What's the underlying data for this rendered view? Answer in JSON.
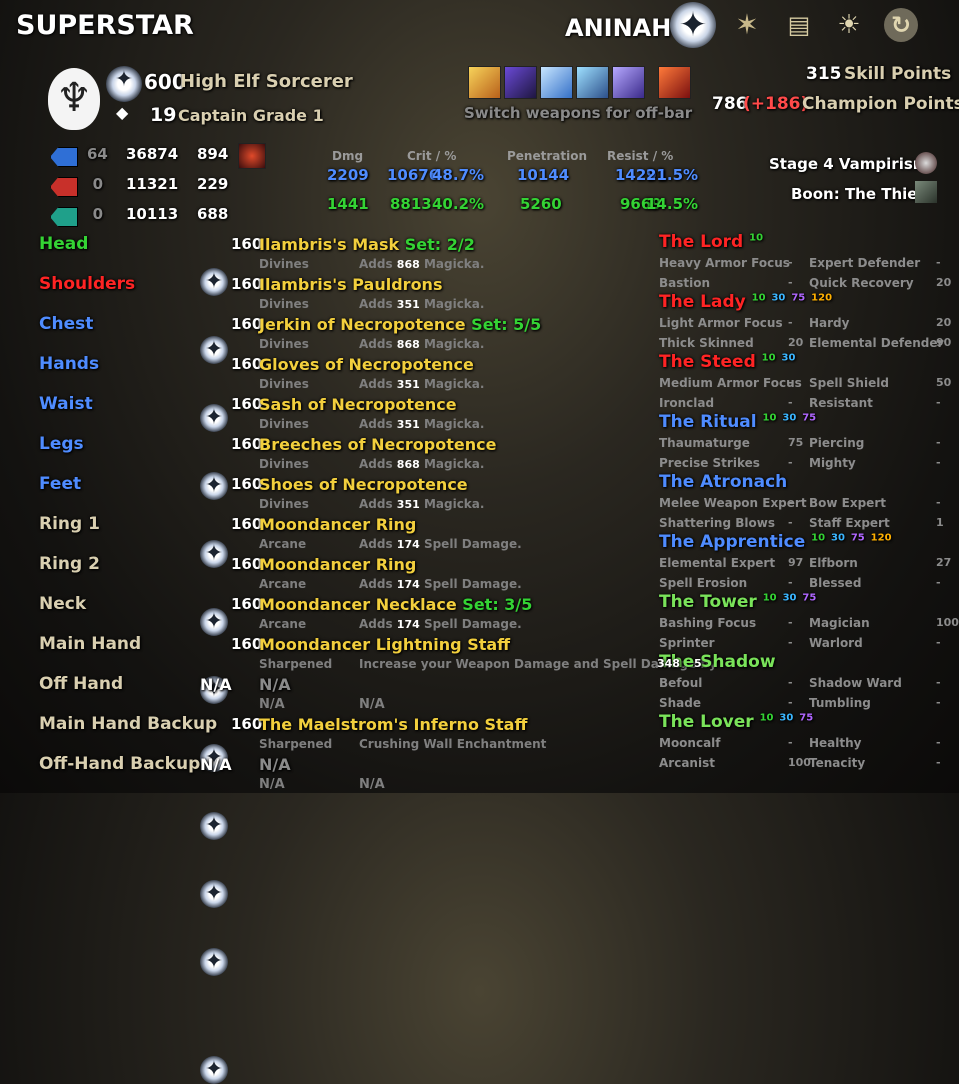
{
  "header": {
    "player_name": "SUPERSTAR",
    "character_name": "ANINAH",
    "nav_icons": [
      "compass-rose-icon",
      "star-compass-icon",
      "scroll-icon",
      "sun-icon",
      "swirl-icon"
    ]
  },
  "character": {
    "level": "600",
    "race_class": "High Elf Sorcerer",
    "rank_num": "19",
    "rank_title": "Captain Grade 1",
    "skill_points_value": "315",
    "skill_points_label": "Skill Points",
    "champion_points_value": "786",
    "champion_points_bonus": "(+186)",
    "champion_points_label": "Champion Points",
    "bar_caption": "Switch weapons for off-bar"
  },
  "resources": [
    {
      "color": "#2f6fd6",
      "a": "64",
      "b": "36874",
      "c": "894"
    },
    {
      "color": "#c8302a",
      "a": "0",
      "b": "11321",
      "c": "229"
    },
    {
      "color": "#1fa08a",
      "a": "0",
      "b": "10113",
      "c": "688"
    }
  ],
  "stats": {
    "headers": [
      "Dmg",
      "Crit / %",
      "Penetration",
      "Resist / %"
    ],
    "row1": {
      "dmg": "2209",
      "crit": "10676",
      "crit_pct": "48.7%",
      "pen": "10144",
      "resist": "14291",
      "resist_pct": "21.5%"
    },
    "row2": {
      "dmg": "1441",
      "crit": "8813",
      "crit_pct": "40.2%",
      "pen": "5260",
      "resist": "9669",
      "resist_pct": "14.5%"
    }
  },
  "buffs": [
    {
      "label": "Stage 4 Vampirism"
    },
    {
      "label": "Boon: The Thief"
    }
  ],
  "gear": [
    {
      "slot": "Head",
      "slot_color": "green",
      "cp": "160",
      "name": "Ilambris's Mask",
      "set": "Set: 2/2",
      "trait": "Divines",
      "adds": "Adds",
      "amount": "868",
      "effect": "Magicka."
    },
    {
      "slot": "Shoulders",
      "slot_color": "red",
      "cp": "160",
      "name": "Ilambris's Pauldrons",
      "set": "",
      "trait": "Divines",
      "adds": "Adds",
      "amount": "351",
      "effect": "Magicka."
    },
    {
      "slot": "Chest",
      "slot_color": "blue",
      "cp": "160",
      "name": "Jerkin of Necropotence",
      "set": "Set: 5/5",
      "trait": "Divines",
      "adds": "Adds",
      "amount": "868",
      "effect": "Magicka."
    },
    {
      "slot": "Hands",
      "slot_color": "blue",
      "cp": "160",
      "name": "Gloves of Necropotence",
      "set": "",
      "trait": "Divines",
      "adds": "Adds",
      "amount": "351",
      "effect": "Magicka."
    },
    {
      "slot": "Waist",
      "slot_color": "blue",
      "cp": "160",
      "name": "Sash of Necropotence",
      "set": "",
      "trait": "Divines",
      "adds": "Adds",
      "amount": "351",
      "effect": "Magicka."
    },
    {
      "slot": "Legs",
      "slot_color": "blue",
      "cp": "160",
      "name": "Breeches of Necropotence",
      "set": "",
      "trait": "Divines",
      "adds": "Adds",
      "amount": "868",
      "effect": "Magicka."
    },
    {
      "slot": "Feet",
      "slot_color": "blue",
      "cp": "160",
      "name": "Shoes of Necropotence",
      "set": "",
      "trait": "Divines",
      "adds": "Adds",
      "amount": "351",
      "effect": "Magicka."
    },
    {
      "slot": "Ring 1",
      "slot_color": "tan",
      "cp": "160",
      "name": "Moondancer Ring",
      "set": "",
      "trait": "Arcane",
      "adds": "Adds",
      "amount": "174",
      "effect": "Spell Damage."
    },
    {
      "slot": "Ring 2",
      "slot_color": "tan",
      "cp": "160",
      "name": "Moondancer Ring",
      "set": "",
      "trait": "Arcane",
      "adds": "Adds",
      "amount": "174",
      "effect": "Spell Damage."
    },
    {
      "slot": "Neck",
      "slot_color": "tan",
      "cp": "160",
      "name": "Moondancer Necklace",
      "set": "Set: 3/5",
      "trait": "Arcane",
      "adds": "Adds",
      "amount": "174",
      "effect": "Spell Damage."
    },
    {
      "slot": "Main Hand",
      "slot_color": "tan",
      "cp": "160",
      "name": "Moondancer Lightning Staff",
      "set": "",
      "trait": "Sharpened",
      "adds": "Increase your Weapon Damage and Spell Damage by",
      "amount": "",
      "effect": ""
    },
    {
      "slot": "Off Hand",
      "slot_color": "tan",
      "cp": "N/A",
      "name": "N/A",
      "set": "",
      "trait": "N/A",
      "adds": "N/A",
      "amount": "",
      "effect": "",
      "empty": true
    },
    {
      "slot": "Main Hand Backup",
      "slot_color": "tan",
      "cp": "160",
      "name": "The Maelstrom's Inferno Staff",
      "set": "",
      "trait": "Sharpened",
      "adds": "Crushing Wall Enchantment",
      "amount": "",
      "effect": ""
    },
    {
      "slot": "Off-Hand Backup",
      "slot_color": "tan",
      "cp": "N/A",
      "name": "N/A",
      "set": "",
      "trait": "N/A",
      "adds": "N/A",
      "amount": "",
      "effect": "",
      "empty": true
    }
  ],
  "champion": [
    {
      "title": "The Lord",
      "title_color": "red",
      "tiers": [
        {
          "v": "10",
          "c": "green"
        }
      ],
      "rows": [
        [
          "Heavy Armor Focus",
          "-",
          "Expert Defender",
          "-"
        ],
        [
          "Bastion",
          "-",
          "Quick Recovery",
          "20"
        ]
      ]
    },
    {
      "title": "The Lady",
      "title_color": "red",
      "tiers": [
        {
          "v": "10",
          "c": "green"
        },
        {
          "v": "30",
          "c": "cyan"
        },
        {
          "v": "75",
          "c": "purple"
        },
        {
          "v": "120",
          "c": "orange"
        }
      ],
      "rows": [
        [
          "Light Armor Focus",
          "-",
          "Hardy",
          "20"
        ],
        [
          "Thick Skinned",
          "20",
          "Elemental Defender",
          "90"
        ]
      ]
    },
    {
      "title": "The Steed",
      "title_color": "red",
      "tiers": [
        {
          "v": "10",
          "c": "green"
        },
        {
          "v": "30",
          "c": "cyan"
        }
      ],
      "rows": [
        [
          "Medium Armor Focus",
          "-",
          "Spell Shield",
          "50"
        ],
        [
          "Ironclad",
          "-",
          "Resistant",
          "-"
        ]
      ]
    },
    {
      "title": "The Ritual",
      "title_color": "blue",
      "tiers": [
        {
          "v": "10",
          "c": "green"
        },
        {
          "v": "30",
          "c": "cyan"
        },
        {
          "v": "75",
          "c": "purple"
        }
      ],
      "rows": [
        [
          "Thaumaturge",
          "75",
          "Piercing",
          "-"
        ],
        [
          "Precise Strikes",
          "-",
          "Mighty",
          "-"
        ]
      ]
    },
    {
      "title": "The Atronach",
      "title_color": "blue",
      "tiers": [],
      "rows": [
        [
          "Melee Weapon Expert",
          "-",
          "Bow Expert",
          "-"
        ],
        [
          "Shattering Blows",
          "-",
          "Staff Expert",
          "1"
        ]
      ]
    },
    {
      "title": "The Apprentice",
      "title_color": "blue",
      "tiers": [
        {
          "v": "10",
          "c": "green"
        },
        {
          "v": "30",
          "c": "cyan"
        },
        {
          "v": "75",
          "c": "purple"
        },
        {
          "v": "120",
          "c": "orange"
        }
      ],
      "rows": [
        [
          "Elemental Expert",
          "97",
          "Elfborn",
          "27"
        ],
        [
          "Spell Erosion",
          "-",
          "Blessed",
          "-"
        ]
      ]
    },
    {
      "title": "The Tower",
      "title_color": "lgreen",
      "tiers": [
        {
          "v": "10",
          "c": "green"
        },
        {
          "v": "30",
          "c": "cyan"
        },
        {
          "v": "75",
          "c": "purple"
        }
      ],
      "rows": [
        [
          "Bashing Focus",
          "-",
          "Magician",
          "100"
        ],
        [
          "Sprinter",
          "-",
          "Warlord",
          "-"
        ]
      ]
    },
    {
      "title": "The Shadow",
      "title_color": "lgreen",
      "tiers": [],
      "rows": [
        [
          "Befoul",
          "-",
          "Shadow Ward",
          "-"
        ],
        [
          "Shade",
          "-",
          "Tumbling",
          "-"
        ]
      ]
    },
    {
      "title": "The Lover",
      "title_color": "lgreen",
      "tiers": [
        {
          "v": "10",
          "c": "green"
        },
        {
          "v": "30",
          "c": "cyan"
        },
        {
          "v": "75",
          "c": "purple"
        }
      ],
      "rows": [
        [
          "Mooncalf",
          "-",
          "Healthy",
          "-"
        ],
        [
          "Arcanist",
          "100",
          "Tenacity",
          "-"
        ]
      ]
    }
  ],
  "overlap": {
    "a": "348",
    "b": "5"
  }
}
